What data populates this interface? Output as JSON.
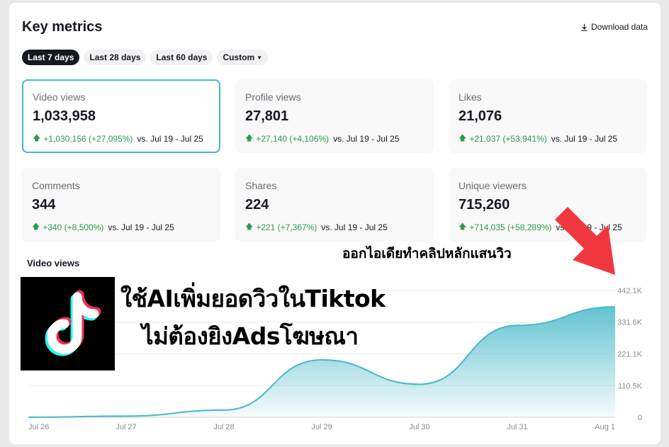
{
  "header": {
    "title": "Key metrics",
    "download_label": "Download data"
  },
  "tabs": [
    {
      "label": "Last 7 days",
      "active": true
    },
    {
      "label": "Last 28 days",
      "active": false
    },
    {
      "label": "Last 60 days",
      "active": false
    },
    {
      "label": "Custom",
      "active": false
    }
  ],
  "metrics": [
    {
      "label": "Video views",
      "value": "1,033,958",
      "delta": "+1,030,156 (+27,095%)",
      "compare": "vs. Jul 19 - Jul 25"
    },
    {
      "label": "Profile views",
      "value": "27,801",
      "delta": "+27,140 (+4,106%)",
      "compare": "vs. Jul 19 - Jul 25"
    },
    {
      "label": "Likes",
      "value": "21,076",
      "delta": "+21,037 (+53,941%)",
      "compare": "vs. Jul 19 - Jul 25"
    },
    {
      "label": "Comments",
      "value": "344",
      "delta": "+340 (+8,500%)",
      "compare": "vs. Jul 19 - Jul 25"
    },
    {
      "label": "Shares",
      "value": "224",
      "delta": "+221 (+7,367%)",
      "compare": "vs. Jul 19 - Jul 25"
    },
    {
      "label": "Unique viewers",
      "value": "715,260",
      "delta": "+714,035 (+58,289%)",
      "compare": "vs. Jul 19 - Jul 25"
    }
  ],
  "chart_data": {
    "type": "area",
    "title": "Video views",
    "x": [
      "Jul 26",
      "Jul 27",
      "Jul 28",
      "Jul 29",
      "Jul 30",
      "Jul 31",
      "Aug 1"
    ],
    "values": [
      0,
      4000,
      25000,
      200000,
      115000,
      320000,
      385000
    ],
    "ylim": [
      0,
      442100
    ],
    "yticks": [
      "0",
      "110.5K",
      "221.1K",
      "331.6K",
      "442.1K"
    ],
    "ytick_values": [
      0,
      110500,
      221100,
      331600,
      442100
    ],
    "grid": true,
    "line_color": "#46b8c8",
    "fill_color": "#46b8c8"
  },
  "overlay": {
    "headline": "ออกไอเดียทำคลิปหลักแสนวิว",
    "promo_line1": "ใช้AIเพิ่มยอดวิวในTiktok",
    "promo_line2": "ไม่ต้องยิงAdsโฆษณา",
    "arrow_color": "#f0373f",
    "logo_icon": "tiktok-logo-icon"
  },
  "colors": {
    "accent": "#46b8c8",
    "positive": "#2b9a4f",
    "dark": "#161823"
  }
}
